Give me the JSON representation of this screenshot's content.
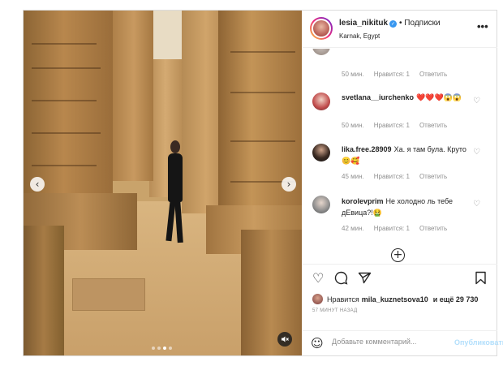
{
  "header": {
    "username": "lesia_nikituk",
    "follow_label": "• Подписки",
    "location": "Karnak, Egypt",
    "more_label": "•••"
  },
  "media": {
    "prev_label": "‹",
    "next_label": "›",
    "mute_label": "🔇",
    "slides_total": 4,
    "active_slide": 3
  },
  "comments": {
    "partial_meta": {
      "time": "50 мин.",
      "likes": "Нравится: 1",
      "reply": "Ответить"
    },
    "items": [
      {
        "username": "svetlana__iurchenko",
        "text": "❤️❤️❤️😱😱",
        "time": "50 мин.",
        "likes": "Нравится: 1",
        "reply": "Ответить"
      },
      {
        "username": "lika.free.28909",
        "text": "Ха. я там була. Круто😊🥰",
        "time": "45 мин.",
        "likes": "Нравится: 1",
        "reply": "Ответить"
      },
      {
        "username": "korolevprim",
        "text": "Не холодно ль тебе дЕвица?!🤮",
        "time": "42 мин.",
        "likes": "Нравится: 1",
        "reply": "Ответить"
      }
    ],
    "load_more_label": "+"
  },
  "actions": {
    "likes_prefix": "Нравится",
    "likes_user": "mila_kuznetsova10",
    "likes_suffix": "и ещё 29 730",
    "time_ago": "57 МИНУТ НАЗАД"
  },
  "comment_box": {
    "placeholder": "Добавьте комментарий...",
    "publish_label": "Опубликовать"
  },
  "colors": {
    "link": "#3897f0",
    "publish_disabled": "#b2dffc",
    "muted": "#8e8e8e"
  }
}
